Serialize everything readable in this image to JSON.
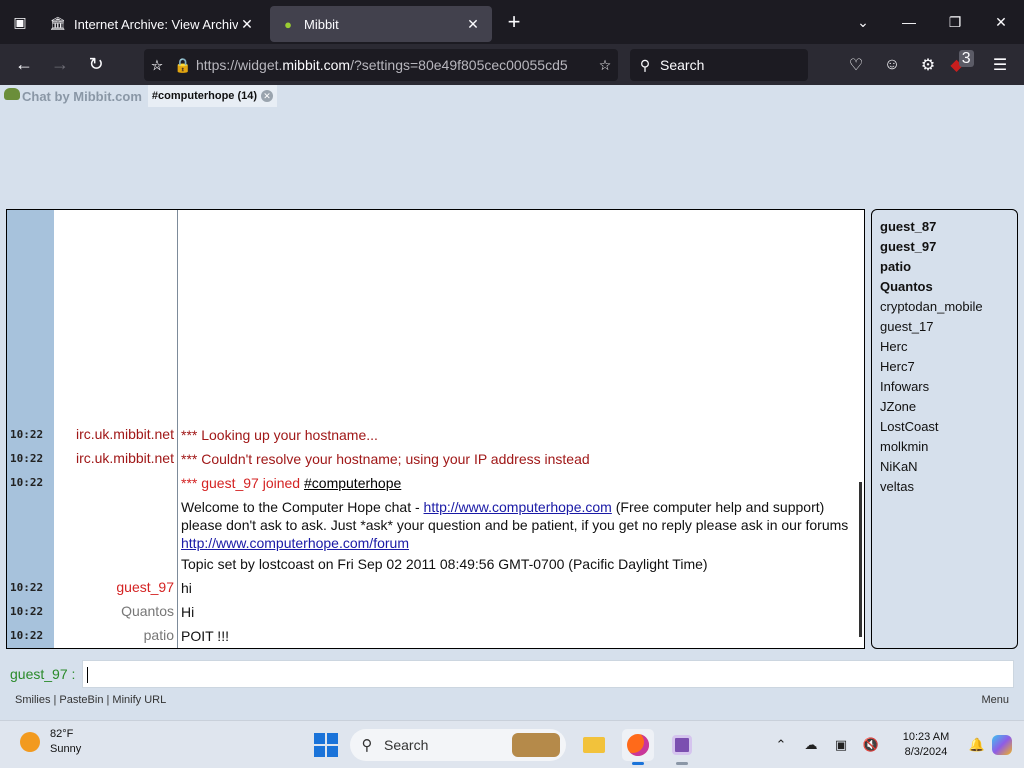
{
  "browser": {
    "tabs": [
      {
        "title": "Internet Archive: View Archive",
        "active": false
      },
      {
        "title": "Mibbit",
        "active": true
      }
    ],
    "url_prefix": "https://widget.",
    "url_domain": "mibbit.com",
    "url_rest": "/?settings=80e49f805cec00055cd5",
    "search_placeholder": "Search",
    "extension_badge": "3"
  },
  "mibbit": {
    "brand": "Chat by Mibbit.com",
    "channel_tab": "#computerhope (14)",
    "messages": [
      {
        "time": "10:22",
        "nick": "irc.uk.mibbit.net",
        "text": "*** Looking up your hostname..."
      },
      {
        "time": "10:22",
        "nick": "irc.uk.mibbit.net",
        "text": "*** Couldn't resolve your hostname; using your IP address instead"
      },
      {
        "time": "10:22",
        "join_text": "*** guest_97 joined ",
        "join_channel": "#computerhope"
      },
      {
        "welcome_1": "Welcome to the Computer Hope chat - ",
        "welcome_link": "http://www.computerhope.com",
        "welcome_2": " (Free computer help and support) please don't ask to ask. Just *ask* your question and be patient, if you get no reply please ask in our forums ",
        "forum_link": "http://www.computerhope.com/forum"
      },
      {
        "topic": "Topic set by lostcoast on Fri Sep 02 2011 08:49:56 GMT-0700 (Pacific Daylight Time)"
      },
      {
        "time": "10:22",
        "nick": "guest_97",
        "text": "hi"
      },
      {
        "time": "10:22",
        "nick": "Quantos",
        "text": "Hi"
      },
      {
        "time": "10:22",
        "nick": "patio",
        "text": "POIT !!!"
      }
    ],
    "users": [
      {
        "name": "guest_87",
        "op": true
      },
      {
        "name": "guest_97",
        "op": true
      },
      {
        "name": "patio",
        "op": true
      },
      {
        "name": "Quantos",
        "op": true
      },
      {
        "name": "cryptodan_mobile",
        "op": false
      },
      {
        "name": "guest_17",
        "op": false
      },
      {
        "name": "Herc",
        "op": false
      },
      {
        "name": "Herc7",
        "op": false
      },
      {
        "name": "Infowars",
        "op": false
      },
      {
        "name": "JZone",
        "op": false
      },
      {
        "name": "LostCoast",
        "op": false
      },
      {
        "name": "molkmin",
        "op": false
      },
      {
        "name": "NiKaN",
        "op": false
      },
      {
        "name": "veltas",
        "op": false
      }
    ],
    "input_nick": "guest_97 :",
    "footer_links": "Smilies | PasteBin | Minify URL",
    "footer_menu": "Menu"
  },
  "taskbar": {
    "temperature": "82°F",
    "condition": "Sunny",
    "search_label": "Search",
    "time": "10:23 AM",
    "date": "8/3/2024"
  }
}
